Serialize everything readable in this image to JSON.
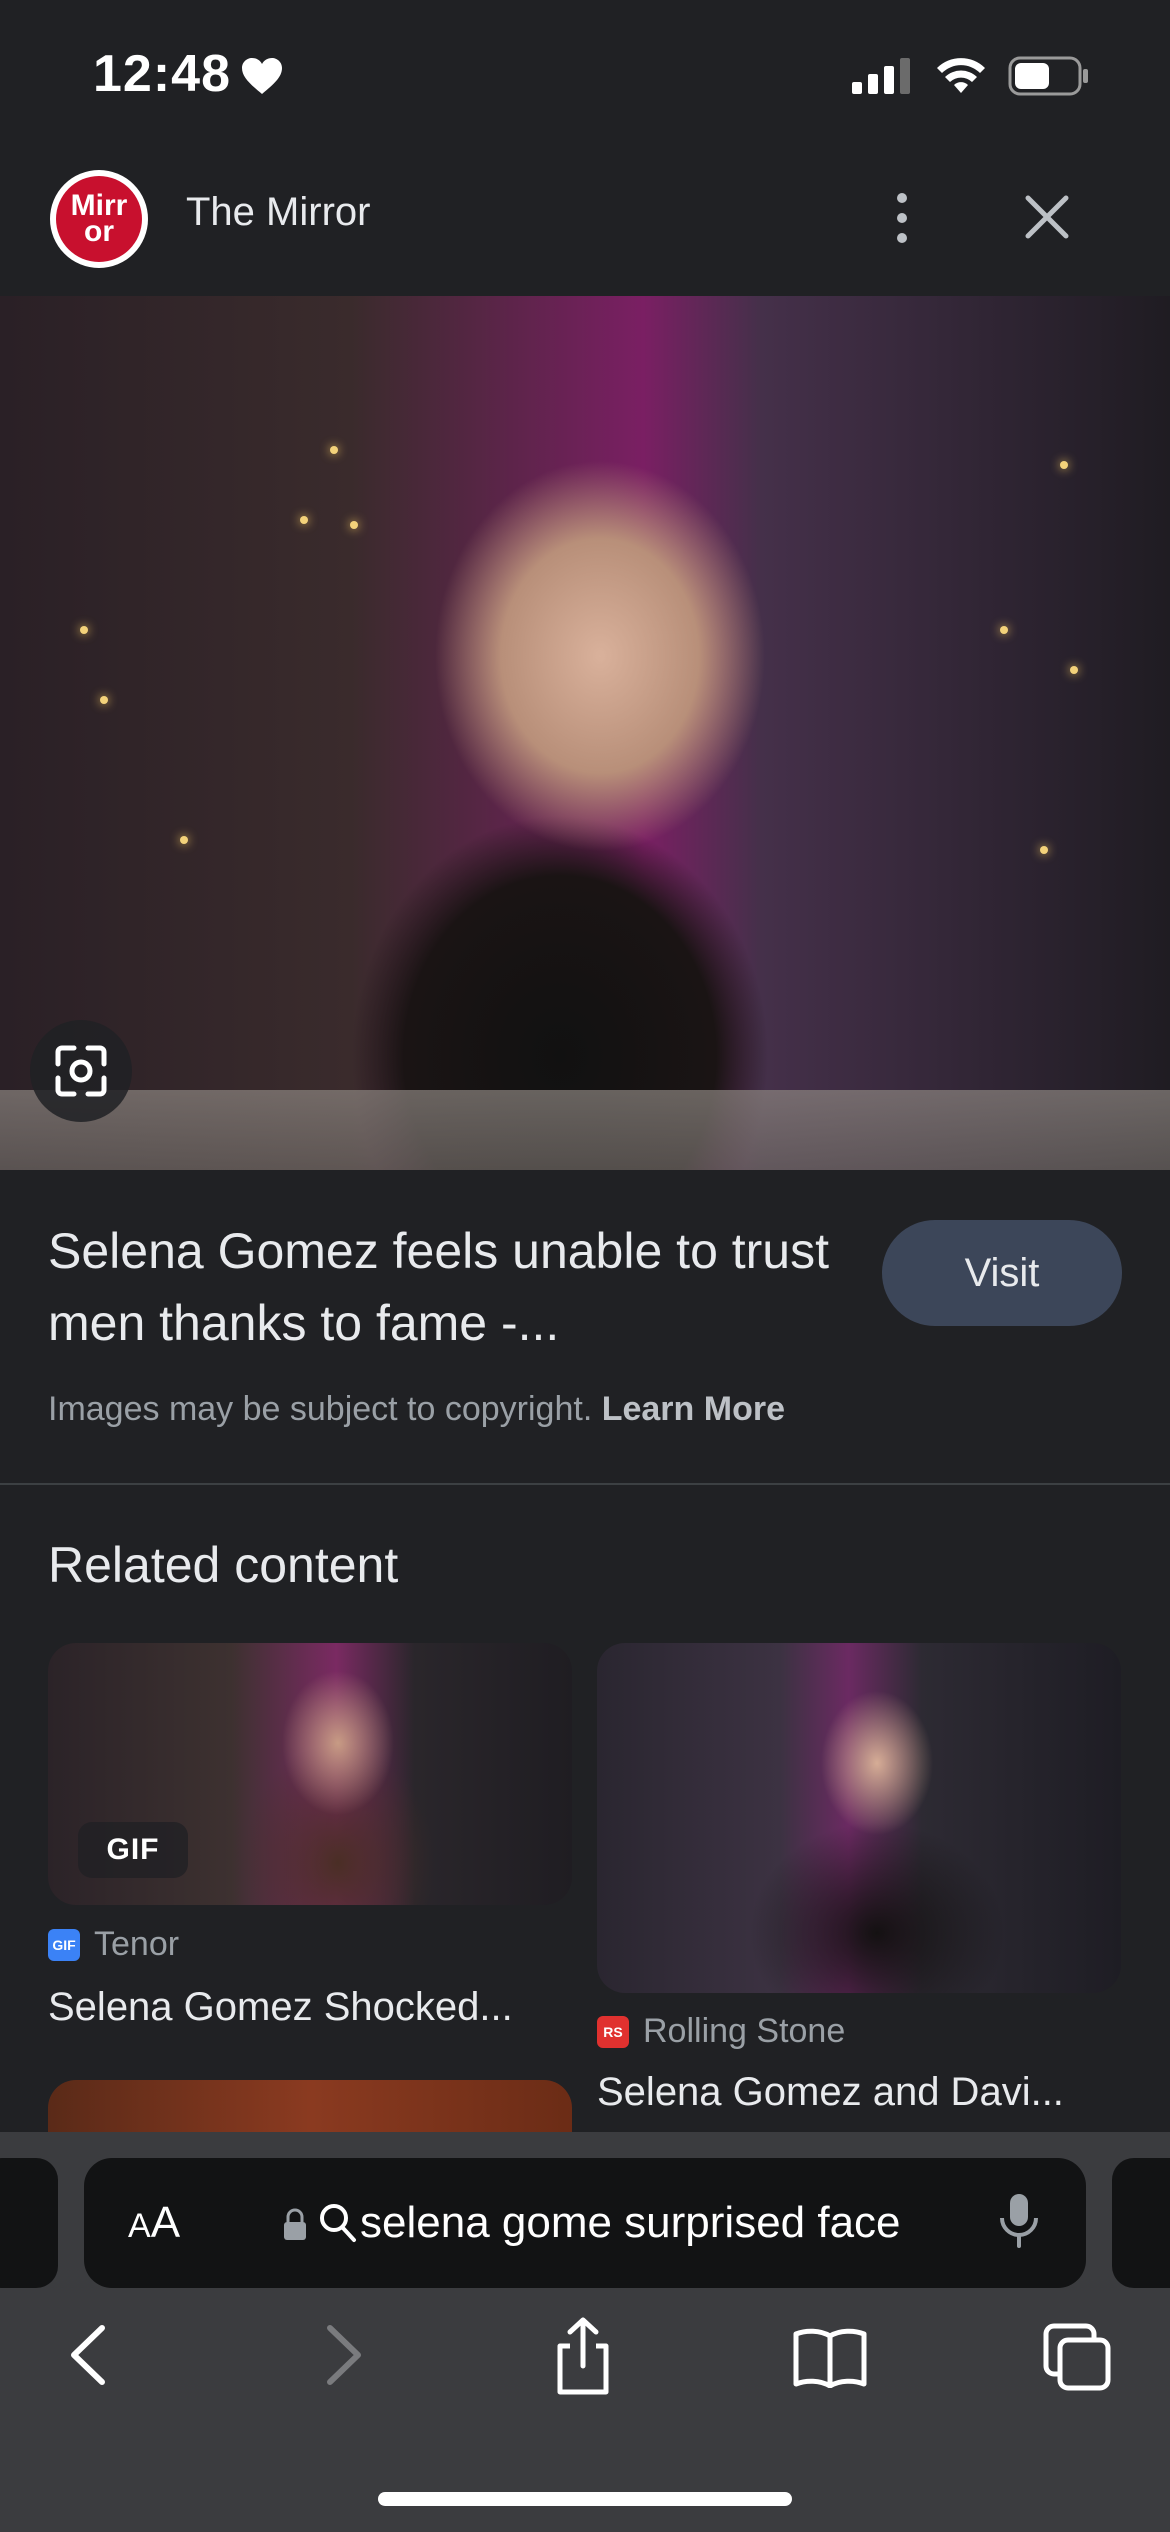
{
  "status_bar": {
    "time": "12:48"
  },
  "header": {
    "site_name": "The Mirror",
    "logo_text": "Mirr or"
  },
  "result": {
    "title": "Selena Gomez feels unable to trust men thanks to fame -...",
    "visit_label": "Visit",
    "copyright_text": "Images may be subject to copyright.",
    "learn_more_label": "Learn More"
  },
  "related": {
    "heading": "Related content",
    "items": [
      {
        "badge": "GIF",
        "source": "Tenor",
        "favicon_text": "GIF",
        "caption": "Selena Gomez Shocked..."
      },
      {
        "source": "Rolling Stone",
        "favicon_text": "RS",
        "caption": "Selena Gomez and Davi..."
      }
    ]
  },
  "browser": {
    "text_size_label_small": "A",
    "text_size_label_large": "A",
    "address": "selena gome surprised face"
  },
  "colors": {
    "background": "#202124",
    "visit_button": "#3c4659",
    "toolbar": "#3b3c3f",
    "mirror_red": "#c8102e"
  }
}
